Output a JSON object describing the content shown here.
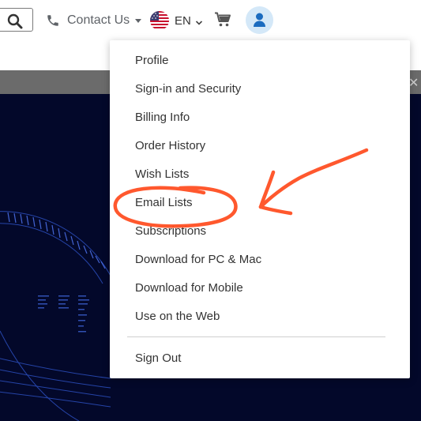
{
  "header": {
    "contact_label": "Contact Us",
    "language_label": "EN"
  },
  "user_menu": {
    "items": [
      "Profile",
      "Sign-in and Security",
      "Billing Info",
      "Order History",
      "Wish Lists",
      "Email Lists",
      "Subscriptions",
      "Download for PC & Mac",
      "Download for Mobile",
      "Use on the Web"
    ],
    "sign_out": "Sign Out",
    "highlighted_item": "Email Lists"
  },
  "colors": {
    "annotation": "#ff4a1c",
    "hero_background": "#03082a",
    "avatar_background": "#d4e8f8",
    "avatar_icon": "#1a6bbf"
  },
  "icons": {
    "search": "search-icon",
    "phone": "phone-icon",
    "flag": "us-flag-icon",
    "cart": "cart-icon",
    "avatar": "user-icon"
  }
}
